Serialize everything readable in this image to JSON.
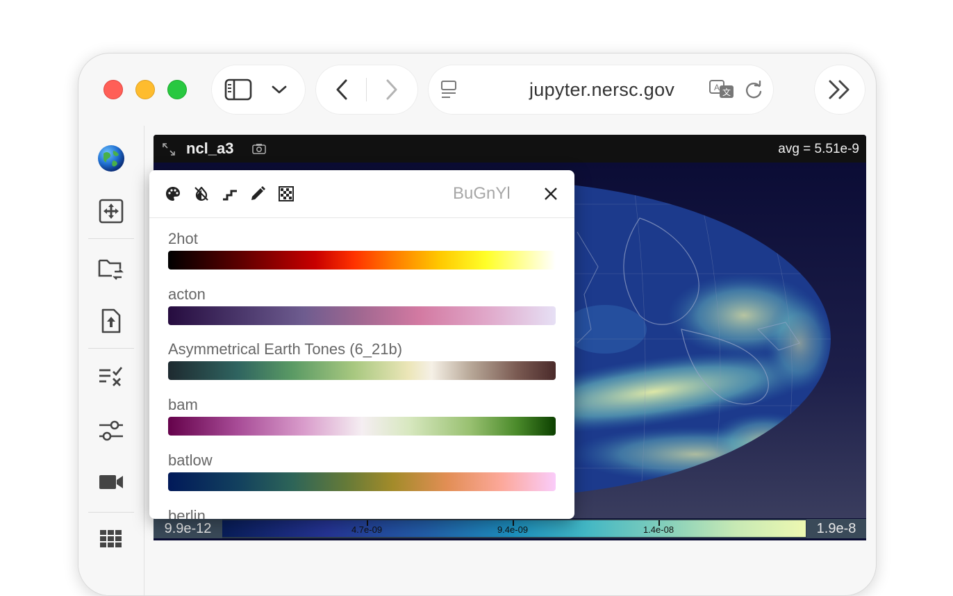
{
  "browser": {
    "url": "jupyter.nersc.gov"
  },
  "viewer": {
    "title": "ncl_a3",
    "avg": "avg = 5.51e-9"
  },
  "colorbar": {
    "min": "9.9e-12",
    "max": "1.9e-8",
    "ticks": [
      "4.7e-09",
      "9.4e-09",
      "1.4e-08"
    ]
  },
  "colormap_panel": {
    "current": "BuGnYl",
    "colormaps": [
      {
        "name": "2hot"
      },
      {
        "name": "acton"
      },
      {
        "name": "Asymmetrical Earth Tones (6_21b)"
      },
      {
        "name": "bam"
      },
      {
        "name": "batlow"
      },
      {
        "name": "berlin"
      }
    ]
  },
  "icons": {
    "sidebar": [
      "globe-icon",
      "move-icon",
      "folder-sync-icon",
      "file-upload-icon",
      "checklist-icon",
      "sliders-icon",
      "video-icon",
      "grid-icon"
    ],
    "panel_tools": [
      "palette-icon",
      "invert-colors-off-icon",
      "stairs-icon",
      "pencil-icon",
      "checkerboard-icon",
      "close-icon"
    ]
  },
  "colors": {
    "viewer_bg": "#0a0c33",
    "header_bg": "#111111"
  }
}
